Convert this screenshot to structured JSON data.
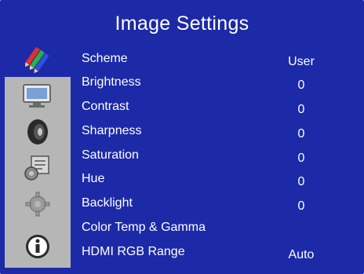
{
  "menu": {
    "title": "Image Settings",
    "sidebar": [
      {
        "icon": "color-pencils-icon",
        "active": true
      },
      {
        "icon": "monitor-display-icon",
        "active": false
      },
      {
        "icon": "speaker-audio-icon",
        "active": false
      },
      {
        "icon": "setup-tools-icon",
        "active": false
      },
      {
        "icon": "gear-advanced-icon",
        "active": false
      },
      {
        "icon": "info-icon",
        "active": false
      }
    ],
    "items": [
      {
        "label": "Scheme",
        "value": "User"
      },
      {
        "label": "Brightness",
        "value": "0"
      },
      {
        "label": "Contrast",
        "value": "0"
      },
      {
        "label": "Sharpness",
        "value": "0"
      },
      {
        "label": "Saturation",
        "value": "0"
      },
      {
        "label": "Hue",
        "value": "0"
      },
      {
        "label": "Backlight",
        "value": "0"
      },
      {
        "label": "Color Temp & Gamma",
        "value": ""
      },
      {
        "label": "HDMI RGB Range",
        "value": "Auto"
      }
    ]
  },
  "colors": {
    "background": "#1c2aa8",
    "sidebar": "#b6b6b6",
    "text": "#ffffff"
  }
}
